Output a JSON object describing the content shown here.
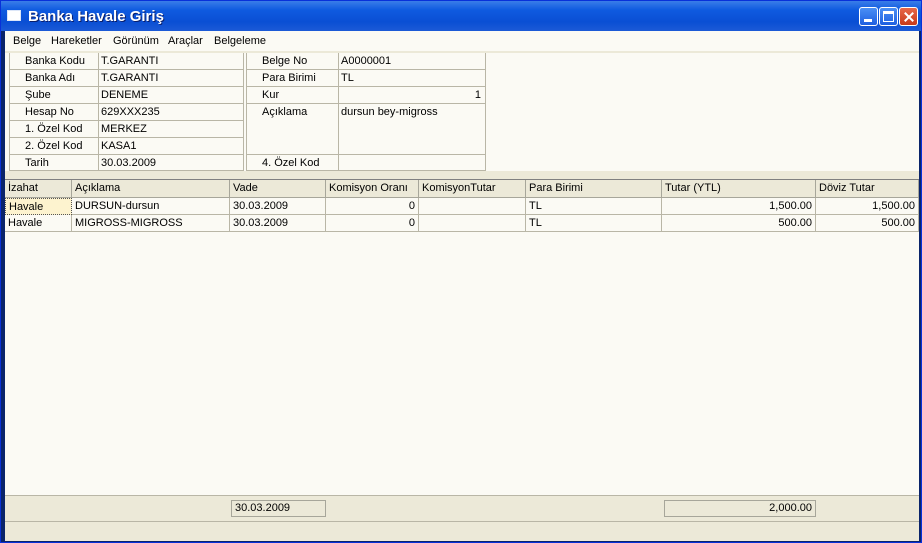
{
  "window": {
    "title": "Banka Havale Giriş"
  },
  "menu": [
    "Belge",
    "Hareketler",
    "Görünüm",
    "Araçlar",
    "Belgeleme"
  ],
  "form": {
    "left": [
      {
        "label": "Banka Kodu",
        "value": "T.GARANTI"
      },
      {
        "label": "Banka Adı",
        "value": "T.GARANTI"
      },
      {
        "label": "Şube",
        "value": "DENEME"
      },
      {
        "label": "Hesap No",
        "value": "629XXX235"
      },
      {
        "label": "1. Özel Kod",
        "value": "MERKEZ"
      },
      {
        "label": "2. Özel Kod",
        "value": "KASA1"
      },
      {
        "label": "Tarih",
        "value": "30.03.2009"
      }
    ],
    "right": {
      "belge_no_label": "Belge No",
      "belge_no": "A0000001",
      "para_birimi_label": "Para Birimi",
      "para_birimi": "TL",
      "kur_label": "Kur",
      "kur": "1",
      "aciklama_label": "Açıklama",
      "aciklama": "dursun bey-migross",
      "ozel_kod4_label": "4. Özel Kod",
      "ozel_kod4": ""
    }
  },
  "grid": {
    "columns": [
      "İzahat",
      "Açıklama",
      "Vade",
      "Komisyon Oranı",
      "KomisyonTutar",
      "Para Birimi",
      "Tutar (YTL)",
      "Döviz Tutar"
    ],
    "rows": [
      [
        "Havale",
        "DURSUN-dursun",
        "30.03.2009",
        "0",
        "",
        "TL",
        "1,500.00",
        "1,500.00"
      ],
      [
        "Havale",
        "MIGROSS-MIGROSS",
        "30.03.2009",
        "0",
        "",
        "TL",
        "500.00",
        "500.00"
      ]
    ]
  },
  "footer": {
    "vade_total": "30.03.2009",
    "tutar_total": "2,000.00"
  }
}
